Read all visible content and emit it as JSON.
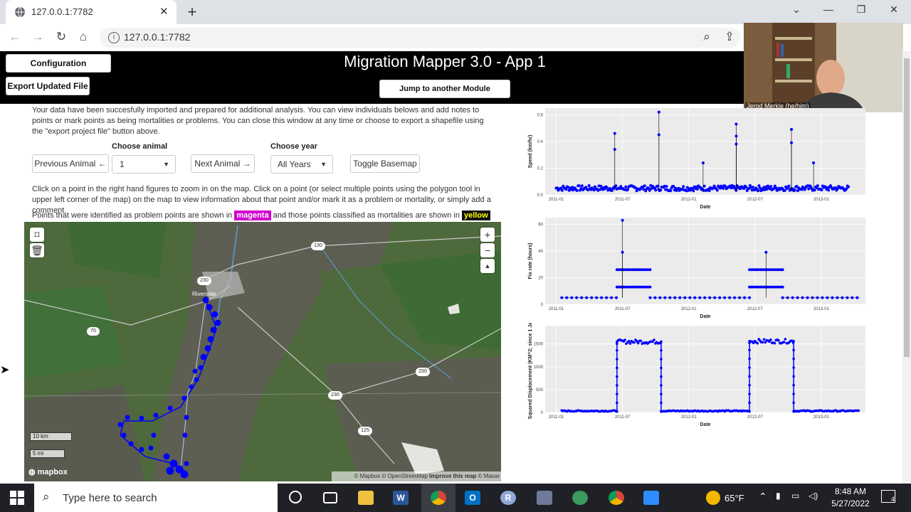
{
  "browser": {
    "tab_title": "127.0.0.1:7782",
    "url": "127.0.0.1:7782"
  },
  "app": {
    "title": "Migration Mapper 3.0 - App 1",
    "config_button": "Configuration Parameters",
    "export_button": "Export Updated File",
    "jump_button": "Jump to another Module"
  },
  "webcam": {
    "name": "Jerod Merkle (he/him)"
  },
  "content": {
    "intro": "Your data have been succesfully imported and prepared for additional analysis. You can view individuals belows and add notes to points or mark points as being mortalities or problems. You can close this window at any time or choose to export a shapefile using the \"export project file\" button above.",
    "prev_button": "Previous Animal ←",
    "choose_animal_label": "Choose animal",
    "animal_value": "1",
    "next_button": "Next Animal →",
    "choose_year_label": "Choose year",
    "year_value": "All Years",
    "basemap_button": "Toggle Basemap",
    "click_info": "Click on a point in the right hand figures to zoom in on the map. Click on a point (or select multiple points using the polygon tool in upper left corner of the map) on the map to view information about that point and/or mark it as a problem or mortality, or simply add a comment.",
    "legend_prefix": "Points that were identified as problem points are shown in",
    "magenta_label": "magenta",
    "legend_middle": "and those points classified as mortalities are shown in",
    "yellow_label": "yellow"
  },
  "map": {
    "zoom_in": "+",
    "zoom_out": "−",
    "reset": "▲",
    "scale_km": "10 km",
    "scale_mi": "5 mi",
    "logo": "mapbox",
    "attribution_a": "© Mapbox © OpenStreetMap",
    "attribution_b": "Improve this map",
    "attribution_c": "© Maxar",
    "town": "Riverside",
    "shields": [
      "130",
      "230",
      "70",
      "230",
      "230",
      "125"
    ],
    "colors": {
      "track": "#0000ff",
      "forest": "#3f6b35",
      "lowland": "#5a5e4e"
    }
  },
  "chart_data": [
    {
      "type": "scatter",
      "ylabel": "Speed (km/hr)",
      "xlabel": "Date",
      "x_ticks": [
        "2011-01",
        "2011-07",
        "2012-01",
        "2012-07",
        "2013-01"
      ],
      "y_ticks": [
        "0.0",
        "0.2",
        "0.4",
        "0.6"
      ],
      "ylim": [
        0,
        0.65
      ],
      "peaks": [
        {
          "x": "2011-06",
          "y": 0.46
        },
        {
          "x": "2011-06",
          "y": 0.34
        },
        {
          "x": "2011-10",
          "y": 0.62
        },
        {
          "x": "2011-10",
          "y": 0.45
        },
        {
          "x": "2012-02",
          "y": 0.24
        },
        {
          "x": "2012-05",
          "y": 0.53
        },
        {
          "x": "2012-05",
          "y": 0.44
        },
        {
          "x": "2012-05",
          "y": 0.38
        },
        {
          "x": "2012-10",
          "y": 0.49
        },
        {
          "x": "2012-10",
          "y": 0.39
        },
        {
          "x": "2012-12",
          "y": 0.24
        }
      ],
      "baseline": 0.03,
      "color": "#0000ff"
    },
    {
      "type": "scatter",
      "ylabel": "Fix rate (hours)",
      "xlabel": "Date",
      "x_ticks": [
        "2011-01",
        "2011-07",
        "2012-01",
        "2012-07",
        "2013-01"
      ],
      "y_ticks": [
        "0",
        "20",
        "40",
        "60"
      ],
      "ylim": [
        0,
        65
      ],
      "levels": [
        {
          "from": "2011-01",
          "to": "2011-06",
          "y": 5
        },
        {
          "from": "2011-06",
          "to": "2011-09",
          "y": 26
        },
        {
          "from": "2011-06",
          "to": "2011-09",
          "y": 13
        },
        {
          "from": "2011-09",
          "to": "2012-06",
          "y": 5
        },
        {
          "from": "2012-06",
          "to": "2012-09",
          "y": 26
        },
        {
          "from": "2012-06",
          "to": "2012-09",
          "y": 13
        },
        {
          "from": "2012-09",
          "to": "2013-04",
          "y": 5
        }
      ],
      "peaks": [
        {
          "x": "2011-07",
          "y": 63
        },
        {
          "x": "2011-07",
          "y": 39
        },
        {
          "x": "2012-08",
          "y": 39
        }
      ],
      "color": "#0000ff"
    },
    {
      "type": "line",
      "ylabel": "Squared Displacement (KM^2; since 1 Jan",
      "xlabel": "Date",
      "x_ticks": [
        "2011-01",
        "2011-07",
        "2012-01",
        "2012-07",
        "2013-01"
      ],
      "y_ticks": [
        "0",
        "500",
        "1000",
        "1500"
      ],
      "ylim": [
        0,
        1900
      ],
      "segments": [
        {
          "from": "2011-01",
          "to": "2011-06",
          "y": 20
        },
        {
          "from": "2011-06",
          "to": "2011-10",
          "y": 1550
        },
        {
          "from": "2011-10",
          "to": "2012-06",
          "y": 20
        },
        {
          "from": "2012-06",
          "to": "2012-10",
          "y": 1560
        },
        {
          "from": "2012-10",
          "to": "2013-04",
          "y": 20
        }
      ],
      "color": "#0000ff"
    }
  ],
  "taskbar": {
    "search_placeholder": "Type here to search",
    "weather": "65°F",
    "time": "8:48 AM",
    "date": "5/27/2022",
    "notifications": "4"
  }
}
